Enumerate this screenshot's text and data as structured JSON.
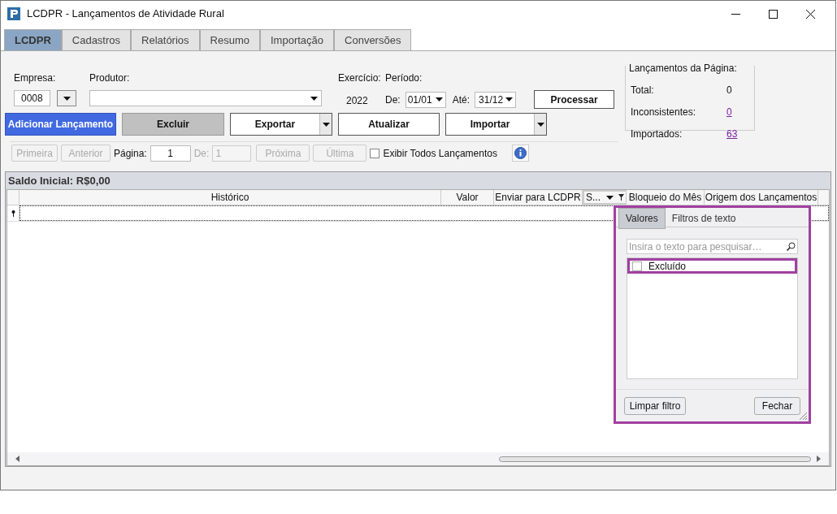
{
  "window": {
    "title": "LCDPR - Lançamentos de Atividade Rural"
  },
  "tabs": [
    {
      "label": "LCDPR",
      "selected": true
    },
    {
      "label": "Cadastros",
      "selected": false
    },
    {
      "label": "Relatórios",
      "selected": false
    },
    {
      "label": "Resumo",
      "selected": false
    },
    {
      "label": "Importação",
      "selected": false
    },
    {
      "label": "Conversões",
      "selected": false
    }
  ],
  "form": {
    "empresa_label": "Empresa:",
    "empresa_value": "0008",
    "produtor_label": "Produtor:",
    "exercicio_label": "Exercício:",
    "exercicio_value": "2022",
    "periodo_label": "Período:",
    "de_label": "De:",
    "de_value": "01/01",
    "ate_label": "Até:",
    "ate_value": "31/12",
    "process_button": "Processar"
  },
  "summary": {
    "title": "Lançamentos da Página:",
    "rows": [
      {
        "label": "Total:",
        "value": "0",
        "link": false
      },
      {
        "label": "Inconsistentes:",
        "value": "0",
        "link": true
      },
      {
        "label": "Importados:",
        "value": "63",
        "link": true
      }
    ]
  },
  "actions": [
    {
      "label": "Adicionar Lançamento",
      "kind": "primary",
      "dropdown": false
    },
    {
      "label": "Excluir",
      "kind": "gray",
      "dropdown": false
    },
    {
      "label": "Exportar",
      "kind": "plain",
      "dropdown": true
    },
    {
      "label": "Atualizar",
      "kind": "plain",
      "dropdown": false
    },
    {
      "label": "Importar",
      "kind": "plain",
      "dropdown": true
    }
  ],
  "pager": {
    "first": "Primeira",
    "prev": "Anterior",
    "page_label": "Página:",
    "page_value": "1",
    "of_label": "De:",
    "of_value": "1",
    "next": "Próxima",
    "last": "Última",
    "show_all": {
      "label": "Exibir Todos Lançamentos",
      "checked": false
    }
  },
  "grid": {
    "caption": "Saldo Inicial: R$0,00",
    "columns": [
      {
        "label": "Histórico",
        "highlighted": false
      },
      {
        "label": "Valor",
        "highlighted": false
      },
      {
        "label": "Enviar para LCDPR",
        "highlighted": false
      },
      {
        "label": "S...",
        "highlighted": true
      },
      {
        "label": "Bloqueio do Mês",
        "highlighted": false
      },
      {
        "label": "Origem dos Lançamentos",
        "highlighted": false
      }
    ]
  },
  "filter_popup": {
    "tabs": [
      {
        "label": "Valores",
        "selected": true
      },
      {
        "label": "Filtros de texto",
        "selected": false
      }
    ],
    "search_placeholder": "Insira o texto para pesquisar…",
    "items": [
      {
        "label": "Excluído",
        "checked": false,
        "highlighted": true
      }
    ],
    "clear_button": "Limpar filtro",
    "close_button": "Fechar"
  }
}
